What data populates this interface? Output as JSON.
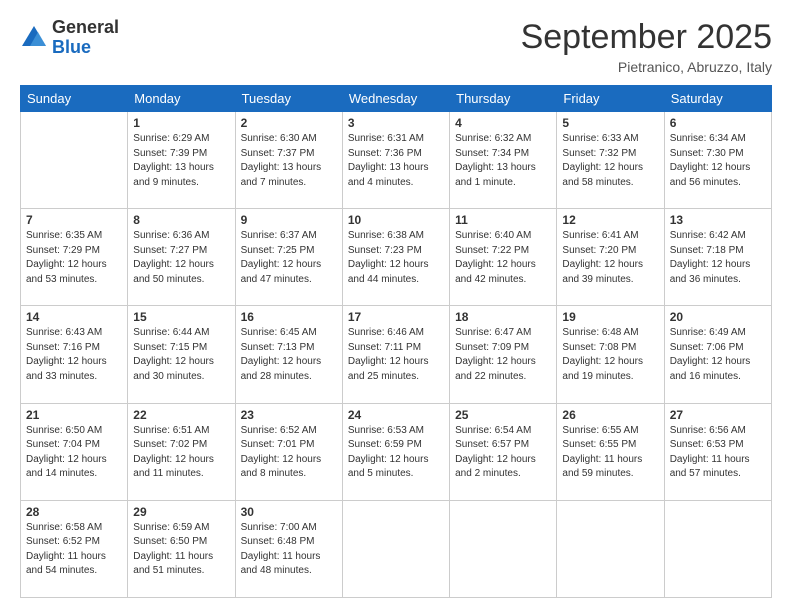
{
  "logo": {
    "general": "General",
    "blue": "Blue"
  },
  "header": {
    "month": "September 2025",
    "location": "Pietranico, Abruzzo, Italy"
  },
  "weekdays": [
    "Sunday",
    "Monday",
    "Tuesday",
    "Wednesday",
    "Thursday",
    "Friday",
    "Saturday"
  ],
  "weeks": [
    [
      {
        "day": "",
        "info": ""
      },
      {
        "day": "1",
        "info": "Sunrise: 6:29 AM\nSunset: 7:39 PM\nDaylight: 13 hours\nand 9 minutes."
      },
      {
        "day": "2",
        "info": "Sunrise: 6:30 AM\nSunset: 7:37 PM\nDaylight: 13 hours\nand 7 minutes."
      },
      {
        "day": "3",
        "info": "Sunrise: 6:31 AM\nSunset: 7:36 PM\nDaylight: 13 hours\nand 4 minutes."
      },
      {
        "day": "4",
        "info": "Sunrise: 6:32 AM\nSunset: 7:34 PM\nDaylight: 13 hours\nand 1 minute."
      },
      {
        "day": "5",
        "info": "Sunrise: 6:33 AM\nSunset: 7:32 PM\nDaylight: 12 hours\nand 58 minutes."
      },
      {
        "day": "6",
        "info": "Sunrise: 6:34 AM\nSunset: 7:30 PM\nDaylight: 12 hours\nand 56 minutes."
      }
    ],
    [
      {
        "day": "7",
        "info": "Sunrise: 6:35 AM\nSunset: 7:29 PM\nDaylight: 12 hours\nand 53 minutes."
      },
      {
        "day": "8",
        "info": "Sunrise: 6:36 AM\nSunset: 7:27 PM\nDaylight: 12 hours\nand 50 minutes."
      },
      {
        "day": "9",
        "info": "Sunrise: 6:37 AM\nSunset: 7:25 PM\nDaylight: 12 hours\nand 47 minutes."
      },
      {
        "day": "10",
        "info": "Sunrise: 6:38 AM\nSunset: 7:23 PM\nDaylight: 12 hours\nand 44 minutes."
      },
      {
        "day": "11",
        "info": "Sunrise: 6:40 AM\nSunset: 7:22 PM\nDaylight: 12 hours\nand 42 minutes."
      },
      {
        "day": "12",
        "info": "Sunrise: 6:41 AM\nSunset: 7:20 PM\nDaylight: 12 hours\nand 39 minutes."
      },
      {
        "day": "13",
        "info": "Sunrise: 6:42 AM\nSunset: 7:18 PM\nDaylight: 12 hours\nand 36 minutes."
      }
    ],
    [
      {
        "day": "14",
        "info": "Sunrise: 6:43 AM\nSunset: 7:16 PM\nDaylight: 12 hours\nand 33 minutes."
      },
      {
        "day": "15",
        "info": "Sunrise: 6:44 AM\nSunset: 7:15 PM\nDaylight: 12 hours\nand 30 minutes."
      },
      {
        "day": "16",
        "info": "Sunrise: 6:45 AM\nSunset: 7:13 PM\nDaylight: 12 hours\nand 28 minutes."
      },
      {
        "day": "17",
        "info": "Sunrise: 6:46 AM\nSunset: 7:11 PM\nDaylight: 12 hours\nand 25 minutes."
      },
      {
        "day": "18",
        "info": "Sunrise: 6:47 AM\nSunset: 7:09 PM\nDaylight: 12 hours\nand 22 minutes."
      },
      {
        "day": "19",
        "info": "Sunrise: 6:48 AM\nSunset: 7:08 PM\nDaylight: 12 hours\nand 19 minutes."
      },
      {
        "day": "20",
        "info": "Sunrise: 6:49 AM\nSunset: 7:06 PM\nDaylight: 12 hours\nand 16 minutes."
      }
    ],
    [
      {
        "day": "21",
        "info": "Sunrise: 6:50 AM\nSunset: 7:04 PM\nDaylight: 12 hours\nand 14 minutes."
      },
      {
        "day": "22",
        "info": "Sunrise: 6:51 AM\nSunset: 7:02 PM\nDaylight: 12 hours\nand 11 minutes."
      },
      {
        "day": "23",
        "info": "Sunrise: 6:52 AM\nSunset: 7:01 PM\nDaylight: 12 hours\nand 8 minutes."
      },
      {
        "day": "24",
        "info": "Sunrise: 6:53 AM\nSunset: 6:59 PM\nDaylight: 12 hours\nand 5 minutes."
      },
      {
        "day": "25",
        "info": "Sunrise: 6:54 AM\nSunset: 6:57 PM\nDaylight: 12 hours\nand 2 minutes."
      },
      {
        "day": "26",
        "info": "Sunrise: 6:55 AM\nSunset: 6:55 PM\nDaylight: 11 hours\nand 59 minutes."
      },
      {
        "day": "27",
        "info": "Sunrise: 6:56 AM\nSunset: 6:53 PM\nDaylight: 11 hours\nand 57 minutes."
      }
    ],
    [
      {
        "day": "28",
        "info": "Sunrise: 6:58 AM\nSunset: 6:52 PM\nDaylight: 11 hours\nand 54 minutes."
      },
      {
        "day": "29",
        "info": "Sunrise: 6:59 AM\nSunset: 6:50 PM\nDaylight: 11 hours\nand 51 minutes."
      },
      {
        "day": "30",
        "info": "Sunrise: 7:00 AM\nSunset: 6:48 PM\nDaylight: 11 hours\nand 48 minutes."
      },
      {
        "day": "",
        "info": ""
      },
      {
        "day": "",
        "info": ""
      },
      {
        "day": "",
        "info": ""
      },
      {
        "day": "",
        "info": ""
      }
    ]
  ]
}
